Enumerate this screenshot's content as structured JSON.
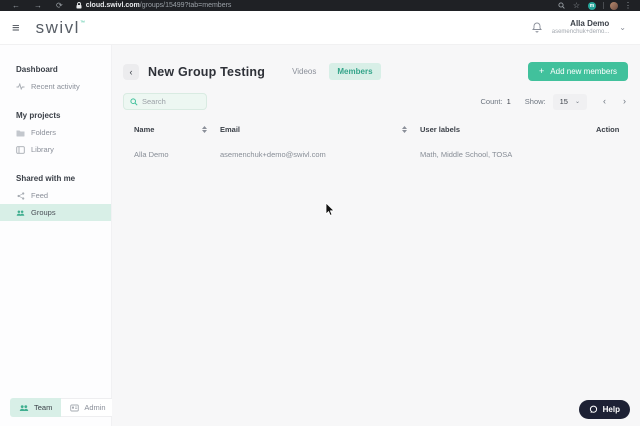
{
  "browser": {
    "url_domain": "cloud.swivl.com",
    "url_path": "/groups/15499?tab=members",
    "extension_badge": "m",
    "back_glyph": "←",
    "forward_glyph": "→",
    "reload_glyph": "⟳",
    "star_glyph": "☆",
    "menu_glyph": "⋮"
  },
  "header": {
    "logo_text": "swivl",
    "logo_tm": "™",
    "user_name": "Alla Demo",
    "user_email": "asemenchuk+demo...",
    "menu_glyph": "≡",
    "chevron_glyph": "⌄"
  },
  "sidebar": {
    "items": [
      {
        "label": "Dashboard",
        "type": "heading"
      },
      {
        "label": "Recent activity",
        "icon": "activity-icon"
      },
      {
        "label": "My projects",
        "type": "heading"
      },
      {
        "label": "Folders",
        "icon": "folder-icon"
      },
      {
        "label": "Library",
        "icon": "library-icon"
      },
      {
        "label": "Shared with me",
        "type": "heading"
      },
      {
        "label": "Feed",
        "icon": "share-icon"
      },
      {
        "label": "Groups",
        "icon": "people-icon",
        "active": true
      }
    ],
    "footer": {
      "team_label": "Team",
      "admin_label": "Admin"
    }
  },
  "main": {
    "back_glyph": "‹",
    "title": "New Group Testing",
    "tabs": [
      {
        "label": "Videos",
        "active": false
      },
      {
        "label": "Members",
        "active": true
      }
    ],
    "add_button": {
      "plus": "+",
      "label": "Add new members"
    },
    "search_placeholder": "Search",
    "count_label": "Count:",
    "count_value": "1",
    "show_label": "Show:",
    "show_value": "15",
    "show_chevron": "⌄",
    "pager_prev": "‹",
    "pager_next": "›",
    "table": {
      "columns": [
        "Name",
        "Email",
        "User labels",
        "Action"
      ],
      "rows": [
        {
          "name": "Alla Demo",
          "email": "asemenchuk+demo@swivl.com",
          "user_labels": "Math, Middle School, TOSA",
          "action": ""
        }
      ]
    }
  },
  "help": {
    "label": "Help"
  },
  "colors": {
    "accent_green": "#41c19c",
    "mint": "#d8efe7",
    "green_text": "#33a489",
    "help_bg": "#1d2134",
    "main_bg": "#f7f7f8",
    "browser_bar": "#1f2125"
  }
}
